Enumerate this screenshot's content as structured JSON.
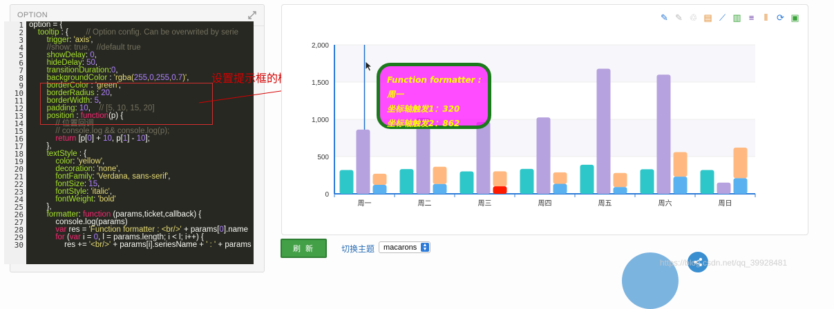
{
  "option_panel": {
    "title": "OPTION",
    "line_numbers": [
      "1",
      "2",
      "3",
      "4",
      "5",
      "6",
      "7",
      "8",
      "9",
      "10",
      "11",
      "12",
      "13",
      "14",
      "15",
      "16",
      "17",
      "18",
      "19",
      "20",
      "21",
      "22",
      "23",
      "24",
      "25",
      "26",
      "27",
      "28",
      "29",
      "30"
    ],
    "code_lines": [
      "option = {",
      "    tooltip : {        // Option config. Can be overwrited by serie",
      "        trigger: 'axis',",
      "        //show: true,   //default true",
      "        showDelay: 0,",
      "        hideDelay: 50,",
      "        transitionDuration:0,",
      "        backgroundColor : 'rgba(255,0,255,0.7)',",
      "        borderColor : 'green',",
      "        borderRadius : 20,",
      "        borderWidth: 5,",
      "        padding: 10,    // [5, 10, 15, 20]",
      "        position : function(p) {",
      "            // 位置回调",
      "            // console.log && console.log(p);",
      "            return [p[0] + 10, p[1] - 10];",
      "        },",
      "        textStyle : {",
      "            color: 'yellow',",
      "            decoration: 'none',",
      "            fontFamily: 'Verdana, sans-serif',",
      "            fontSize: 15,",
      "            fontStyle: 'italic',",
      "            fontWeight: 'bold'",
      "        },",
      "        formatter: function (params,ticket,callback) {",
      "            console.log(params)",
      "            var res = 'Function formatter : <br/>' + params[0].name",
      "            for (var i = 0, l = params.length; i < l; i++) {",
      "                res += '<br/>' + params[i].seriesName + ' : ' + params"
    ]
  },
  "annotation": {
    "text": "设置提示框的样式"
  },
  "toolbox": {
    "icons": [
      "mark-icon",
      "edit-icon",
      "delete-icon",
      "data-view-icon",
      "line-chart-icon",
      "bar-chart-icon",
      "stack-icon",
      "tiled-icon",
      "restore-icon",
      "save-icon"
    ],
    "colors": [
      "#2d7bd8",
      "#bbbbbb",
      "#bbbbbb",
      "#e08a2d",
      "#2d7bd8",
      "#3aa43a",
      "#6a3aa4",
      "#e08a2d",
      "#2d7bd8",
      "#3aa43a"
    ]
  },
  "tooltip": {
    "lines": [
      "Function formatter :",
      "周一",
      "坐标轴触发1：320",
      "坐标轴触发2：862"
    ]
  },
  "chart_data": {
    "type": "bar",
    "categories": [
      "周一",
      "周二",
      "周三",
      "周四",
      "周五",
      "周六",
      "周日"
    ],
    "y_ticks": [
      "0",
      "500",
      "1,000",
      "1,500",
      "2,000"
    ],
    "ylim": [
      0,
      2000
    ],
    "series": [
      {
        "color": "#2ec7c9",
        "values": [
          320,
          332,
          301,
          334,
          390,
          330,
          320
        ]
      },
      {
        "color": "#b6a2de",
        "values": [
          862,
          1018,
          964,
          1026,
          1679,
          1600,
          150
        ]
      },
      {
        "color": "#ffb980",
        "stack": "s",
        "values": [
          150,
          232,
          201,
          154,
          190,
          330,
          410
        ]
      },
      {
        "color": "#5ab1ef",
        "stack": "s",
        "values": [
          120,
          132,
          101,
          134,
          90,
          230,
          210
        ]
      }
    ],
    "highlight": {
      "series": 3,
      "index": 2,
      "color": "#ff1a00"
    },
    "highlight_top": {
      "series": 2,
      "index": 2,
      "color": "#ffb980"
    },
    "axis_pointer_index": 0
  },
  "controls": {
    "refresh_label": "刷 新",
    "theme_label": "切换主题",
    "theme_value": "macarons"
  },
  "watermark": "https://blog.csdn.net/qq_39928481"
}
